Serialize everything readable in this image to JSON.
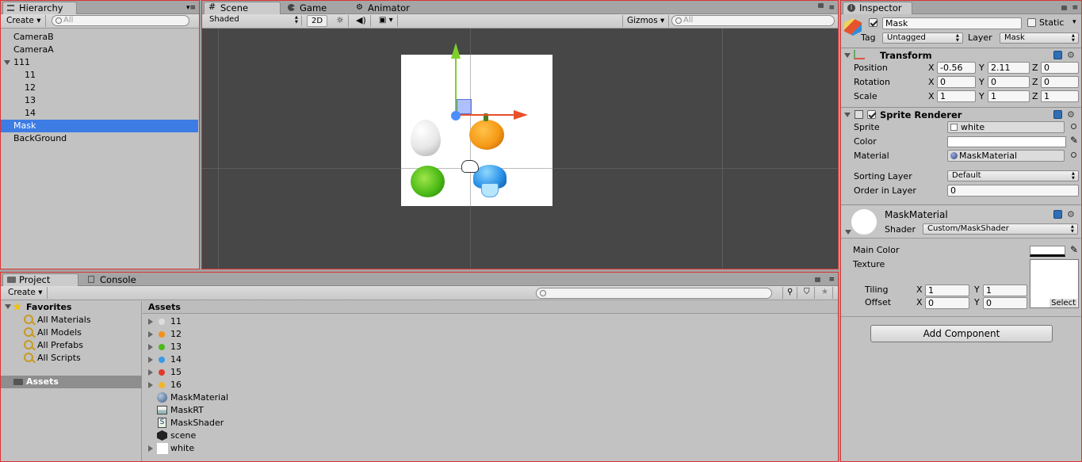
{
  "hierarchy": {
    "tab": "Hierarchy",
    "create": "Create",
    "search_placeholder": "All",
    "items": [
      {
        "label": "CameraB",
        "indent": 0
      },
      {
        "label": "CameraA",
        "indent": 0
      },
      {
        "label": "111",
        "indent": 0,
        "expanded": true
      },
      {
        "label": "11",
        "indent": 1
      },
      {
        "label": "12",
        "indent": 1
      },
      {
        "label": "13",
        "indent": 1
      },
      {
        "label": "14",
        "indent": 1
      },
      {
        "label": "Mask",
        "indent": 0,
        "selected": true
      },
      {
        "label": "BackGround",
        "indent": 0
      }
    ]
  },
  "scene": {
    "tabs": [
      "Scene",
      "Game",
      "Animator"
    ],
    "shading": "Shaded",
    "mode_2d": "2D",
    "gizmos": "Gizmos",
    "search_placeholder": "All",
    "sprites": [
      "egg",
      "pumpkin",
      "cabbage",
      "mushroom"
    ]
  },
  "project": {
    "tabs": [
      "Project",
      "Console"
    ],
    "create": "Create",
    "favorites_label": "Favorites",
    "favorites": [
      "All Materials",
      "All Models",
      "All Prefabs",
      "All Scripts"
    ],
    "assets_folder": "Assets",
    "assets_header": "Assets",
    "assets": [
      {
        "label": "11",
        "icon": "sprite-white-icon",
        "expandable": true
      },
      {
        "label": "12",
        "icon": "sprite-orange-icon",
        "expandable": true
      },
      {
        "label": "13",
        "icon": "sprite-green-icon",
        "expandable": true
      },
      {
        "label": "14",
        "icon": "sprite-blue-icon",
        "expandable": true
      },
      {
        "label": "15",
        "icon": "sprite-red-icon",
        "expandable": true
      },
      {
        "label": "16",
        "icon": "sprite-yellow-icon",
        "expandable": true
      },
      {
        "label": "MaskMaterial",
        "icon": "material-icon",
        "expandable": false
      },
      {
        "label": "MaskRT",
        "icon": "render-texture-icon",
        "expandable": false
      },
      {
        "label": "MaskShader",
        "icon": "shader-icon",
        "expandable": false
      },
      {
        "label": "scene",
        "icon": "unity-scene-icon",
        "expandable": false
      },
      {
        "label": "white",
        "icon": "texture-white-icon",
        "expandable": true
      }
    ]
  },
  "inspector": {
    "tab": "Inspector",
    "object_name": "Mask",
    "static_label": "Static",
    "tag_label": "Tag",
    "tag_value": "Untagged",
    "layer_label": "Layer",
    "layer_value": "Mask",
    "transform": {
      "title": "Transform",
      "position_label": "Position",
      "rotation_label": "Rotation",
      "scale_label": "Scale",
      "position": [
        "-0.56",
        "2.11",
        "0"
      ],
      "rotation": [
        "0",
        "0",
        "0"
      ],
      "scale": [
        "1",
        "1",
        "1"
      ],
      "axis": [
        "X",
        "Y",
        "Z"
      ]
    },
    "sprite_renderer": {
      "title": "Sprite Renderer",
      "sprite_label": "Sprite",
      "sprite_value": "white",
      "color_label": "Color",
      "material_label": "Material",
      "material_value": "MaskMaterial",
      "sorting_layer_label": "Sorting Layer",
      "sorting_layer_value": "Default",
      "order_label": "Order in Layer",
      "order_value": "0"
    },
    "material": {
      "name": "MaskMaterial",
      "shader_label": "Shader",
      "shader_value": "Custom/MaskShader",
      "main_color_label": "Main Color",
      "texture_label": "Texture",
      "tiling_label": "Tiling",
      "offset_label": "Offset",
      "tiling": [
        "1",
        "1"
      ],
      "offset": [
        "0",
        "0"
      ],
      "select_label": "Select"
    },
    "add_component": "Add Component"
  }
}
